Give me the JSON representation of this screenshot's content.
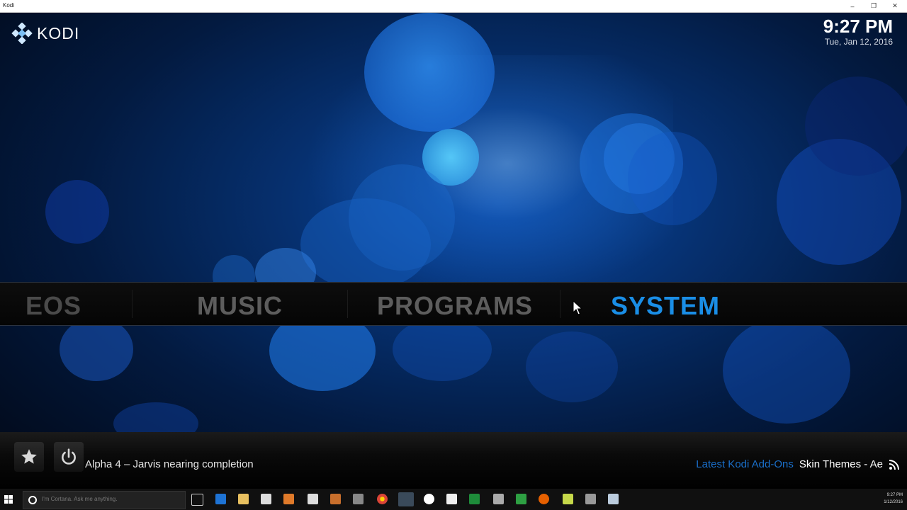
{
  "window": {
    "title": "Kodi",
    "controls": [
      "minimize-icon",
      "restore-icon",
      "close-icon"
    ]
  },
  "kodi": {
    "logo_text": "KODI",
    "clock": {
      "time": "9:27 PM",
      "date": "Tue, Jan 12, 2016"
    },
    "menu": [
      {
        "label": "EOS",
        "active": false
      },
      {
        "label": "MUSIC",
        "active": false
      },
      {
        "label": "PROGRAMS",
        "active": false
      },
      {
        "label": "SYSTEM",
        "active": true
      }
    ],
    "ticker_text": "Alpha 4 – Jarvis nearing completion",
    "addons_label": "Latest Kodi Add-Ons",
    "addons_value": "Skin Themes - Ae",
    "buttons": [
      "favourites-star-icon",
      "power-icon"
    ],
    "colors": {
      "accent": "#1a8ee6",
      "inactive_menu": "#5d5d5d",
      "addons_label": "#1a6fc9"
    }
  },
  "taskbar": {
    "search_placeholder": "I'm Cortana. Ask me anything.",
    "tray_time": "9:27 PM",
    "tray_date": "1/12/2016"
  }
}
